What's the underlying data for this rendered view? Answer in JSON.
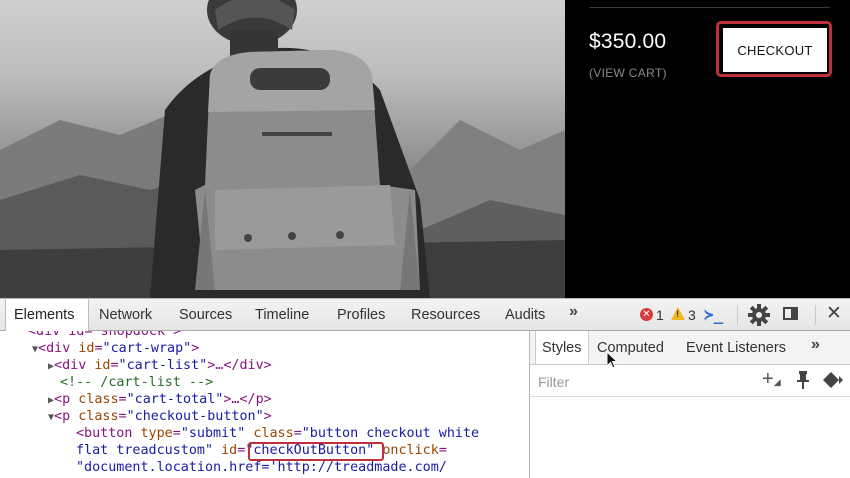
{
  "cart": {
    "total": "$350.00",
    "view_cart": "(VIEW CART)",
    "checkout_label": "CHECKOUT"
  },
  "devtools": {
    "tabs": [
      "Elements",
      "Network",
      "Sources",
      "Timeline",
      "Profiles",
      "Resources",
      "Audits"
    ],
    "overflow": "»",
    "error_count": "1",
    "warning_count": "3",
    "close": "✕",
    "console_glyph": "≻_"
  },
  "styles_pane": {
    "tabs": [
      "Styles",
      "Computed",
      "Event Listeners"
    ],
    "overflow": "»",
    "filter_placeholder": "Filter"
  },
  "dom": {
    "l0": "<div id=\"shopdock\">",
    "l1_open": "<div",
    "l1_attr": "id",
    "l1_val": "\"cart-wrap\"",
    "l2_attr": "id",
    "l2_val": "\"cart-list\"",
    "l2_rest": ">…</div>",
    "l3_comment": "<!-- /cart-list -->",
    "l4_attr": "class",
    "l4_val": "\"cart-total\"",
    "l4_rest": ">…</p>",
    "l5_attr": "class",
    "l5_val": "\"checkout-button\"",
    "l6_tag": "<button",
    "l6_attr1": "type",
    "l6_val1": "\"submit\"",
    "l6_attr2": "class",
    "l6_val2": "\"button checkout white",
    "l7_val2b": "flat treadcustom\"",
    "l7_attr3": "id",
    "l7_val3": "\"checkOutButton\"",
    "l7_attr4": "onclick",
    "l8_val4": "\"document.location.href='http://treadmade.com/"
  }
}
